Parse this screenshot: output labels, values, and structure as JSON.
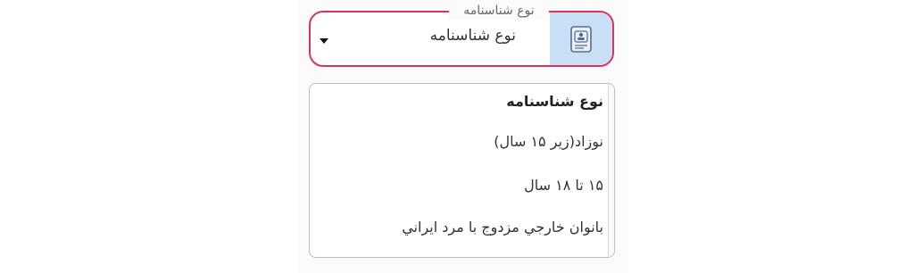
{
  "field": {
    "label": "نوع شناسنامه",
    "selected_value": "نوع شناسنامه",
    "icon": "id-card-icon",
    "border_color": "#d9345c",
    "icon_bg": "#c9dff5"
  },
  "dropdown": {
    "options": [
      {
        "label": "نوع شناسنامه",
        "selected": true
      },
      {
        "label": "نوزاد(زیر ۱۵ سال)",
        "selected": false
      },
      {
        "label": "۱۵ تا ۱۸ سال",
        "selected": false
      },
      {
        "label": "بانوان خارجي مزدوج با مرد ايراني",
        "selected": false
      }
    ]
  }
}
